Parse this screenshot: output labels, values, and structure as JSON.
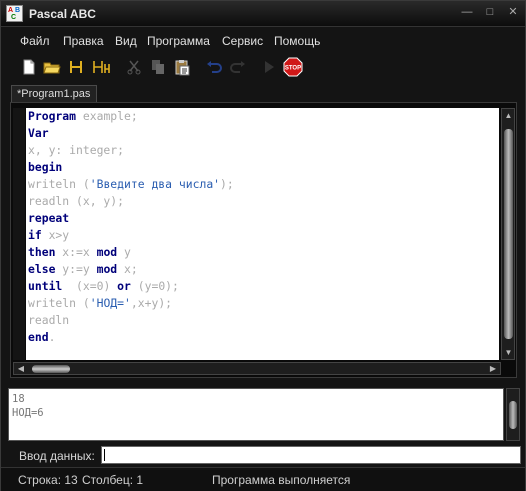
{
  "window": {
    "title": "Pascal ABC"
  },
  "menu": [
    "Файл",
    "Правка",
    "Вид",
    "Программа",
    "Сервис",
    "Помощь"
  ],
  "toolbar": {
    "icons": [
      "new-file-icon",
      "open-folder-icon",
      "save-icon",
      "save-all-icon",
      "cut-icon",
      "copy-icon",
      "paste-icon",
      "undo-icon",
      "redo-icon",
      "run-icon",
      "stop-icon"
    ],
    "stop_label": "STOP"
  },
  "tab": {
    "label": "*Program1.pas"
  },
  "editor": {
    "lines": [
      [
        {
          "t": "Program",
          "c": "kw"
        },
        {
          "t": " example;",
          "c": "p"
        }
      ],
      [
        {
          "t": "Var",
          "c": "kw"
        }
      ],
      [
        {
          "t": "x, y: integer;",
          "c": "p"
        }
      ],
      [
        {
          "t": "begin",
          "c": "kw"
        }
      ],
      [
        {
          "t": "writeln (",
          "c": "p"
        },
        {
          "t": "'Введите два числа'",
          "c": "str"
        },
        {
          "t": ");",
          "c": "p"
        }
      ],
      [
        {
          "t": "readln (x, y);",
          "c": "p"
        }
      ],
      [
        {
          "t": "repeat",
          "c": "kw"
        }
      ],
      [
        {
          "t": "if",
          "c": "kw"
        },
        {
          "t": " x>y",
          "c": "p"
        }
      ],
      [
        {
          "t": "then",
          "c": "kw"
        },
        {
          "t": " x:=x ",
          "c": "p"
        },
        {
          "t": "mod",
          "c": "kw"
        },
        {
          "t": " y",
          "c": "p"
        }
      ],
      [
        {
          "t": "else",
          "c": "kw"
        },
        {
          "t": " y:=y ",
          "c": "p"
        },
        {
          "t": "mod",
          "c": "kw"
        },
        {
          "t": " x;",
          "c": "p"
        }
      ],
      [
        {
          "t": "until",
          "c": "kw"
        },
        {
          "t": "  (x=0) ",
          "c": "p"
        },
        {
          "t": "or",
          "c": "kw"
        },
        {
          "t": " (y=0);",
          "c": "p"
        }
      ],
      [
        {
          "t": "writeln (",
          "c": "p"
        },
        {
          "t": "'НОД='",
          "c": "str"
        },
        {
          "t": ",x+y);",
          "c": "p"
        }
      ],
      [
        {
          "t": "readln",
          "c": "p"
        }
      ],
      [
        {
          "t": "end",
          "c": "kw"
        },
        {
          "t": ".",
          "c": "p"
        }
      ]
    ]
  },
  "output": {
    "lines": [
      "18",
      "НОД=6"
    ]
  },
  "input": {
    "label": "Ввод данных:",
    "value": ""
  },
  "status": {
    "row": "Строка: 13",
    "col": "Столбец: 1",
    "message": "Программа выполняется"
  }
}
